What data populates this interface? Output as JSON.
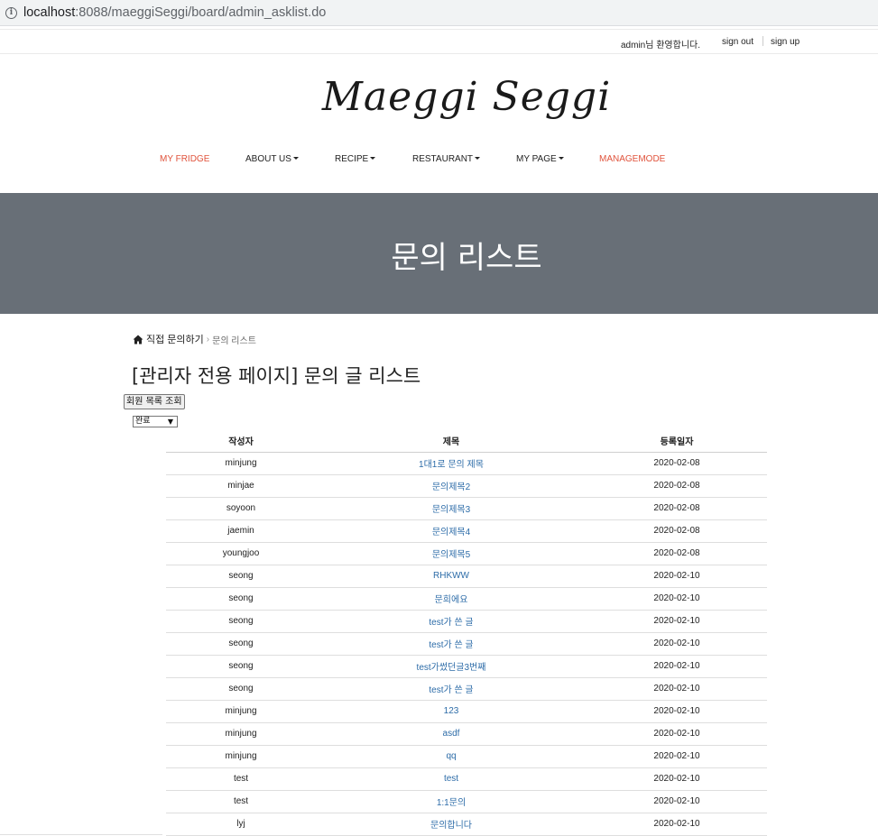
{
  "browser": {
    "url_host": "localhost",
    "url_rest": ":8088/maeggiSeggi/board/admin_asklist.do"
  },
  "topbar": {
    "welcome": "admin님 환영합니다.",
    "signout": "sign out",
    "signup": "sign up"
  },
  "logo": "Maeggi Seggi",
  "nav": [
    {
      "label": "MY FRIDGE",
      "dropdown": false,
      "accent": true
    },
    {
      "label": "ABOUT US",
      "dropdown": true,
      "accent": false
    },
    {
      "label": "RECIPE",
      "dropdown": true,
      "accent": false
    },
    {
      "label": "RESTAURANT",
      "dropdown": true,
      "accent": false
    },
    {
      "label": "MY PAGE",
      "dropdown": true,
      "accent": false
    },
    {
      "label": "MANAGEMODE",
      "dropdown": false,
      "accent": true
    }
  ],
  "hero": {
    "title": "문의 리스트"
  },
  "breadcrumb": {
    "home": "직접 문의하기",
    "separator": "›",
    "current": "문의 리스트"
  },
  "page_title": "[관리자 전용 페이지] 문의 글 리스트",
  "member_button": "회원 목록 조회",
  "filter_select": {
    "value": "완료"
  },
  "table": {
    "headers": [
      "작성자",
      "제목",
      "등록일자"
    ],
    "rows": [
      [
        "minjung",
        "1대1로 문의 제목",
        "2020-02-08"
      ],
      [
        "minjae",
        "문의제목2",
        "2020-02-08"
      ],
      [
        "soyoon",
        "문의제목3",
        "2020-02-08"
      ],
      [
        "jaemin",
        "문의제목4",
        "2020-02-08"
      ],
      [
        "youngjoo",
        "문의제목5",
        "2020-02-08"
      ],
      [
        "seong",
        "RHKWW",
        "2020-02-10"
      ],
      [
        "seong",
        "문희에요",
        "2020-02-10"
      ],
      [
        "seong",
        "test가 쓴 글",
        "2020-02-10"
      ],
      [
        "seong",
        "test가 쓴 글",
        "2020-02-10"
      ],
      [
        "seong",
        "test가썼던글3번째",
        "2020-02-10"
      ],
      [
        "seong",
        "test가 쓴 글",
        "2020-02-10"
      ],
      [
        "minjung",
        "123",
        "2020-02-10"
      ],
      [
        "minjung",
        "asdf",
        "2020-02-10"
      ],
      [
        "minjung",
        "qq",
        "2020-02-10"
      ],
      [
        "test",
        "test",
        "2020-02-10"
      ],
      [
        "test",
        "1:1문의",
        "2020-02-10"
      ],
      [
        "lyj",
        "문의합니다",
        "2020-02-10"
      ]
    ]
  },
  "colors": {
    "accent": "#e0533c",
    "hero_bg": "#686f77",
    "link": "#2d6ca8"
  }
}
